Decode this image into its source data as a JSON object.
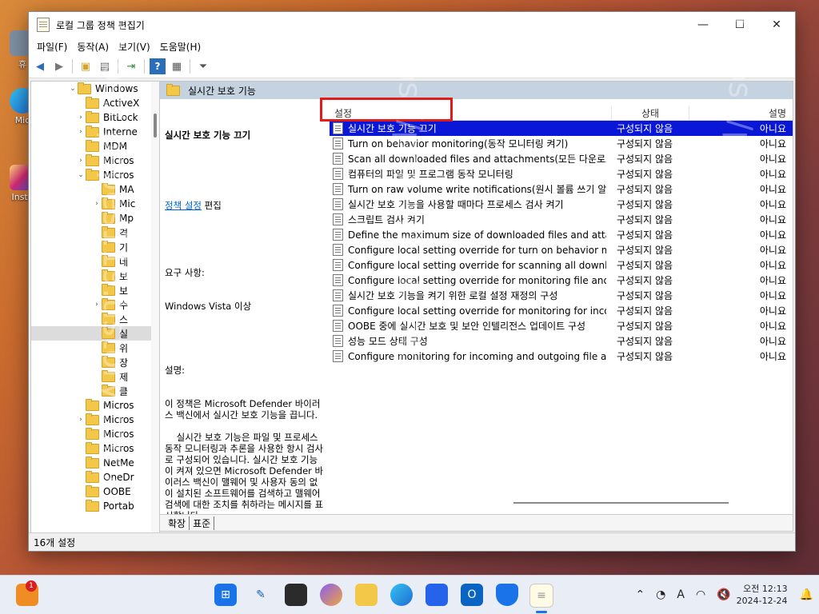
{
  "window": {
    "title": "로컬 그룹 정책 편집기",
    "controls": [
      "—",
      "☐",
      "✕"
    ]
  },
  "menu": [
    "파일(F)",
    "동작(A)",
    "보기(V)",
    "도움말(H)"
  ],
  "tree": [
    {
      "label": "Windows",
      "exp": "⌄"
    },
    {
      "label": "ActiveX",
      "exp": ""
    },
    {
      "label": "BitLock",
      "exp": "›"
    },
    {
      "label": "Interne",
      "exp": "›"
    },
    {
      "label": "MDM",
      "exp": ""
    },
    {
      "label": "Micros",
      "exp": "›"
    },
    {
      "label": "Micros",
      "exp": "⌄"
    },
    {
      "label": "MA",
      "exp": ""
    },
    {
      "label": "Mic",
      "exp": "›"
    },
    {
      "label": "Mp",
      "exp": ""
    },
    {
      "label": "격",
      "exp": ""
    },
    {
      "label": "기",
      "exp": ""
    },
    {
      "label": "네",
      "exp": ""
    },
    {
      "label": "보",
      "exp": ""
    },
    {
      "label": "보",
      "exp": ""
    },
    {
      "label": "수",
      "exp": "›"
    },
    {
      "label": "스",
      "exp": ""
    },
    {
      "label": "실",
      "exp": ""
    },
    {
      "label": "위",
      "exp": ""
    },
    {
      "label": "장",
      "exp": ""
    },
    {
      "label": "제",
      "exp": ""
    },
    {
      "label": "클",
      "exp": ""
    },
    {
      "label": "Micros",
      "exp": ""
    },
    {
      "label": "Micros",
      "exp": "›"
    },
    {
      "label": "Micros",
      "exp": ""
    },
    {
      "label": "Micros",
      "exp": ""
    },
    {
      "label": "NetMe",
      "exp": ""
    },
    {
      "label": "OneDr",
      "exp": ""
    },
    {
      "label": "OOBE",
      "exp": ""
    },
    {
      "label": "Portab",
      "exp": ""
    }
  ],
  "breadcrumb": "실시간 보호 기능",
  "description": {
    "heading": "실시간 보호 기능 끄기",
    "link": "정책 설정",
    "edit": "편집",
    "req_label": "요구 사항:",
    "req_value": "Windows Vista 이상",
    "desc_label": "설명:",
    "desc_body": "이 정책은 Microsoft Defender 바이러스 백신에서 실시간 보호 기능을 끕니다.\n\n    실시간 보호 기능은 파일 및 프로세스 동작 모니터링과 추론을 사용한 항시 검사로 구성되어 있습니다. 실시간 보호 기능이 켜져 있으면 Microsoft Defender 바이러스 백신이 맬웨어 및 사용자 동의 없이 설치된 소프트웨어를 검색하고 맬웨어 검색에 대한 조치를 취하라는 메시지를 표시합니다.\n\n    이 정책 설정을 사용하면 실시간 보호 기능이 꺼집니다.\n\n    이 정책 설정을 사용하지 않거나 구성하지 않으면 실시간 보호 기능이 켜집니다."
  },
  "list": {
    "headers": {
      "setting": "설정",
      "state": "상태",
      "note": "설명"
    },
    "rows": [
      {
        "setting": "실시간 보호 기능 끄기",
        "state": "구성되지 않음",
        "note": "아니요"
      },
      {
        "setting": "Turn on behavior monitoring(동작 모니터링 켜기)",
        "state": "구성되지 않음",
        "note": "아니요"
      },
      {
        "setting": "Scan all downloaded files and attachments(모든 다운로드...",
        "state": "구성되지 않음",
        "note": "아니요"
      },
      {
        "setting": "컴퓨터의 파일 및 프로그램 동작 모니터링",
        "state": "구성되지 않음",
        "note": "아니요"
      },
      {
        "setting": "Turn on raw volume write notifications(원시 볼륨 쓰기 알...",
        "state": "구성되지 않음",
        "note": "아니요"
      },
      {
        "setting": "실시간 보호 기능을 사용할 때마다 프로세스 검사 켜기",
        "state": "구성되지 않음",
        "note": "아니요"
      },
      {
        "setting": "스크립트 검사 켜기",
        "state": "구성되지 않음",
        "note": "아니요"
      },
      {
        "setting": "Define the maximum size of downloaded files and attach...",
        "state": "구성되지 않음",
        "note": "아니요"
      },
      {
        "setting": "Configure local setting override for turn on behavior moni...",
        "state": "구성되지 않음",
        "note": "아니요"
      },
      {
        "setting": "Configure local setting override for scanning all download...",
        "state": "구성되지 않음",
        "note": "아니요"
      },
      {
        "setting": "Configure local setting override for monitoring file and pr...",
        "state": "구성되지 않음",
        "note": "아니요"
      },
      {
        "setting": "실시간 보호 기능을 켜기 위한 로컬 설정 재정의 구성",
        "state": "구성되지 않음",
        "note": "아니요"
      },
      {
        "setting": "Configure local setting override for monitoring for incomi...",
        "state": "구성되지 않음",
        "note": "아니요"
      },
      {
        "setting": "OOBE 중에 실시간 보호 및 보안 인텔리전스 업데이트 구성",
        "state": "구성되지 않음",
        "note": "아니요"
      },
      {
        "setting": "성능 모드 상태 구성",
        "state": "구성되지 않음",
        "note": "아니요"
      },
      {
        "setting": "Configure monitoring for incoming and outgoing file and ...",
        "state": "구성되지 않음",
        "note": "아니요"
      }
    ]
  },
  "tabs": [
    "확장",
    "표준"
  ],
  "status": "16개 설정",
  "watermark": "https://pepes119.tistory.com/",
  "desktop": [
    {
      "label": "휴",
      "icon": "recycle-bin-icon"
    },
    {
      "label": "Mic",
      "icon": "edge-icon"
    },
    {
      "label": "Insta",
      "icon": "instagram-icon"
    }
  ],
  "taskbar": {
    "notification_badge": "1",
    "time": "오전 12:13",
    "date": "2024-12-24",
    "ime": "A"
  },
  "colors": {
    "selected_row": "#0a17d6",
    "highlight_box": "#e31b1b",
    "crumb_bg": "#c5d2e0"
  }
}
